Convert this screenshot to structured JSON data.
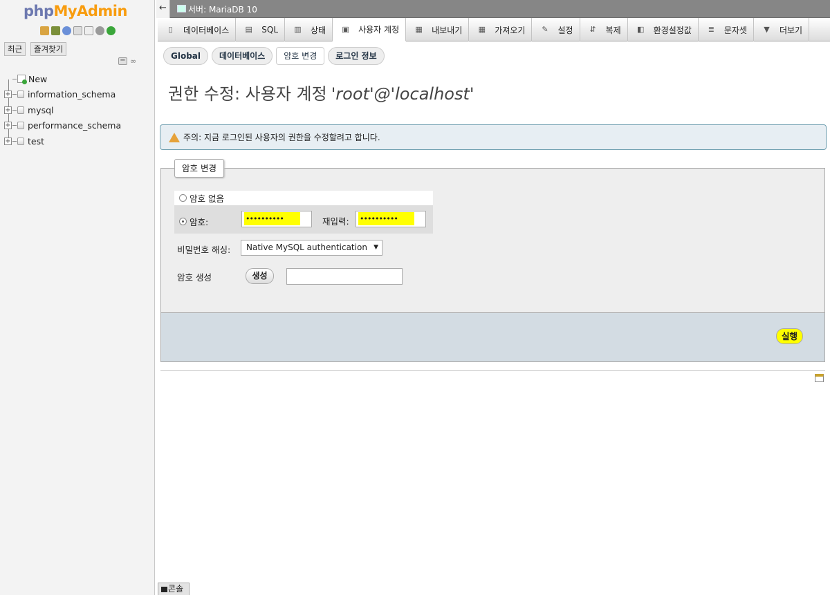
{
  "nav": {
    "logo_php": "php",
    "logo_myadmin": "MyAdmin",
    "recent_label": "최근",
    "favorites_label": "즐겨찾기",
    "databases": [
      {
        "name": "New"
      },
      {
        "name": "information_schema"
      },
      {
        "name": "mysql"
      },
      {
        "name": "performance_schema"
      },
      {
        "name": "test"
      }
    ]
  },
  "topbar": {
    "back_arrow": "←",
    "server_label": "서버: MariaDB 10"
  },
  "tabs": [
    {
      "label": "데이터베이스",
      "icon": "database-icon"
    },
    {
      "label": "SQL",
      "icon": "sql-icon"
    },
    {
      "label": "상태",
      "icon": "status-chart-icon"
    },
    {
      "label": "사용자 계정",
      "icon": "user-accounts-icon",
      "active": true
    },
    {
      "label": "내보내기",
      "icon": "export-icon"
    },
    {
      "label": "가져오기",
      "icon": "import-icon"
    },
    {
      "label": "설정",
      "icon": "wrench-icon"
    },
    {
      "label": "복제",
      "icon": "replication-icon"
    },
    {
      "label": "환경설정값",
      "icon": "variables-icon"
    },
    {
      "label": "문자셋",
      "icon": "charset-icon"
    },
    {
      "label": "더보기",
      "icon": "triangle-down-icon"
    }
  ],
  "subtabs": [
    {
      "label": "Global"
    },
    {
      "label": "데이터베이스"
    },
    {
      "label": "암호 변경",
      "active": true
    },
    {
      "label": "로그인 정보"
    }
  ],
  "page": {
    "title_prefix": "권한 수정: 사용자 계정",
    "title_user": "'root'@'localhost'",
    "notice_text": "주의: 지금 로그인된 사용자의 권한을 수정할려고 합니다."
  },
  "password_form": {
    "legend": "암호 변경",
    "no_password_label": "암호 없음",
    "password_label": "암호:",
    "password_value": "••••••••••",
    "retype_label": "재입력:",
    "retype_value": "••••••••••",
    "hashing_label": "비밀번호 해싱:",
    "hashing_selected": "Native MySQL authentication",
    "generate_label": "암호 생성",
    "generate_button": "생성",
    "generated_value": "",
    "go_button": "실행"
  },
  "console_label": "콘솔",
  "colors": {
    "highlight": "#ffff00",
    "logo_php": "#6c78af",
    "logo_myadmin": "#f89c0e",
    "notice_border": "#6f9fb0"
  }
}
